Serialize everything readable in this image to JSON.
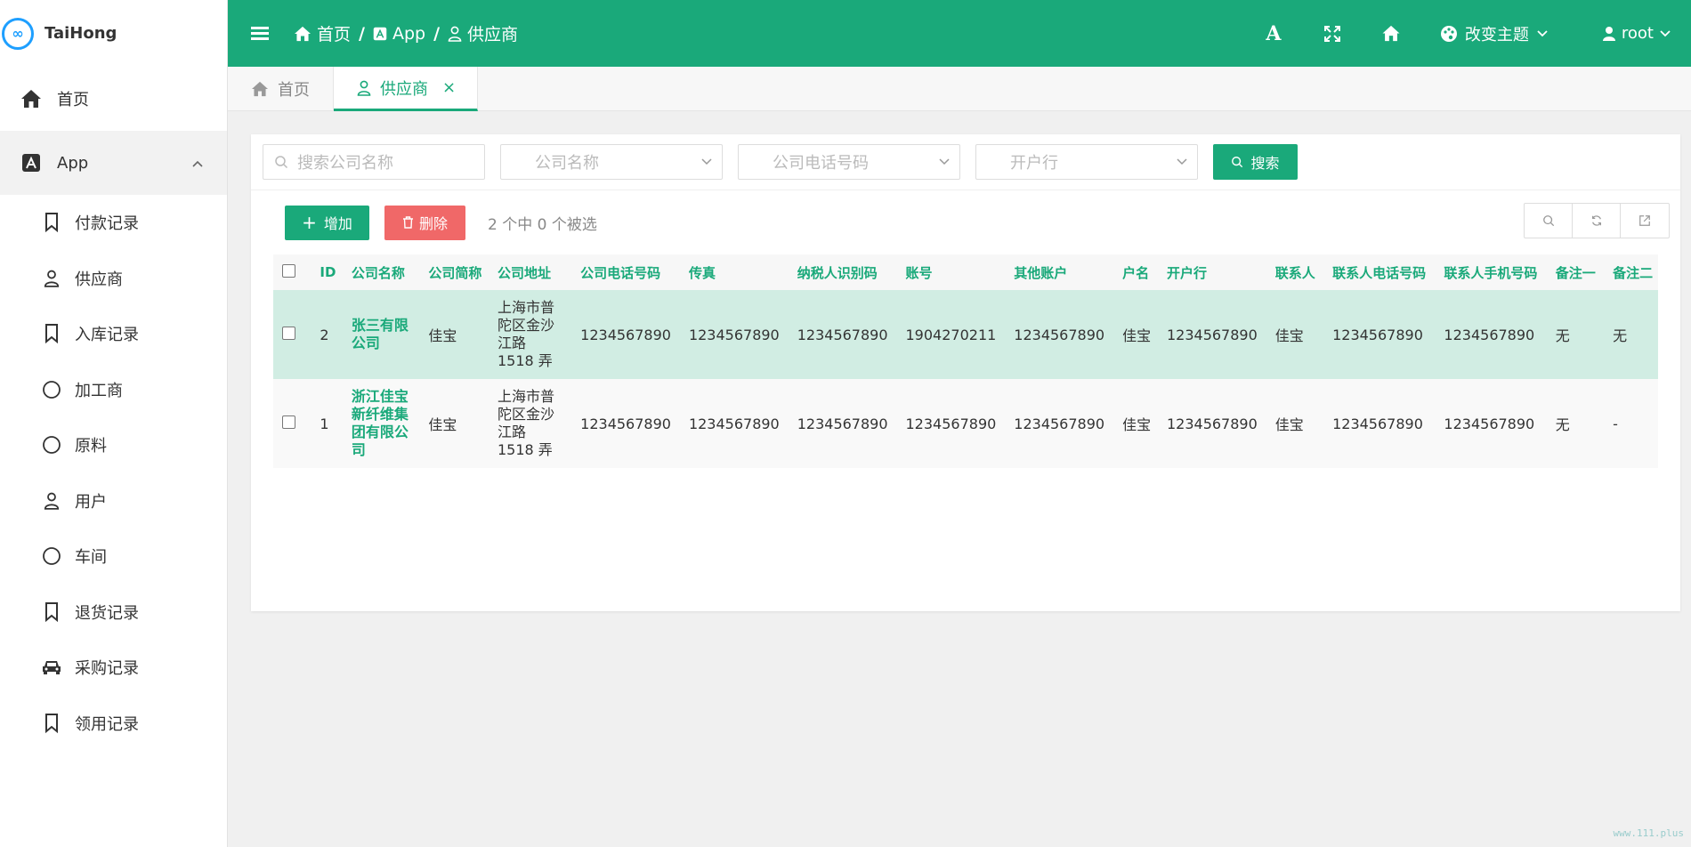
{
  "app": {
    "name": "TaiHong",
    "logo_text": "∞"
  },
  "sidebar": {
    "home": "首页",
    "app_group": "App",
    "items": [
      {
        "label": "付款记录",
        "icon": "bookmark-icon"
      },
      {
        "label": "供应商",
        "icon": "user-icon"
      },
      {
        "label": "入库记录",
        "icon": "bookmark-icon"
      },
      {
        "label": "加工商",
        "icon": "circle-icon"
      },
      {
        "label": "原料",
        "icon": "circle-icon"
      },
      {
        "label": "用户",
        "icon": "user-icon"
      },
      {
        "label": "车间",
        "icon": "circle-icon"
      },
      {
        "label": "退货记录",
        "icon": "bookmark-icon"
      },
      {
        "label": "采购记录",
        "icon": "car-icon"
      },
      {
        "label": "领用记录",
        "icon": "bookmark-icon"
      }
    ]
  },
  "header": {
    "breadcrumb": [
      "首页",
      "App",
      "供应商"
    ],
    "theme_label": "改变主题",
    "user": "root",
    "font_icon_text": "A"
  },
  "tabs": {
    "home": "首页",
    "active": "供应商"
  },
  "filters": {
    "search_placeholder": "搜索公司名称",
    "company_placeholder": "公司名称",
    "phone_placeholder": "公司电话号码",
    "bank_placeholder": "开户行",
    "search_button": "搜索"
  },
  "toolbar": {
    "add": "增加",
    "delete": "删除",
    "selection_info": "2 个中 0 个被选"
  },
  "table": {
    "columns": [
      "ID",
      "公司名称",
      "公司简称",
      "公司地址",
      "公司电话号码",
      "传真",
      "纳税人识别码",
      "账号",
      "其他账户",
      "户名",
      "开户行",
      "联系人",
      "联系人电话号码",
      "联系人手机号码",
      "备注一",
      "备注二"
    ],
    "rows": [
      [
        "2",
        "张三有限公司",
        "佳宝",
        "上海市普陀区金沙江路 1518 弄",
        "1234567890",
        "1234567890",
        "1234567890",
        "1904270211",
        "1234567890",
        "佳宝",
        "1234567890",
        "佳宝",
        "1234567890",
        "1234567890",
        "无",
        "无"
      ],
      [
        "1",
        "浙江佳宝新纤维集团有限公司",
        "佳宝",
        "上海市普陀区金沙江路 1518 弄",
        "1234567890",
        "1234567890",
        "1234567890",
        "1234567890",
        "1234567890",
        "佳宝",
        "1234567890",
        "佳宝",
        "1234567890",
        "1234567890",
        "无",
        "-"
      ]
    ]
  },
  "watermark": "www.111.plus",
  "colors": {
    "primary": "#1aa97a",
    "danger": "#f06868",
    "row_highlight": "#d1ede3"
  }
}
